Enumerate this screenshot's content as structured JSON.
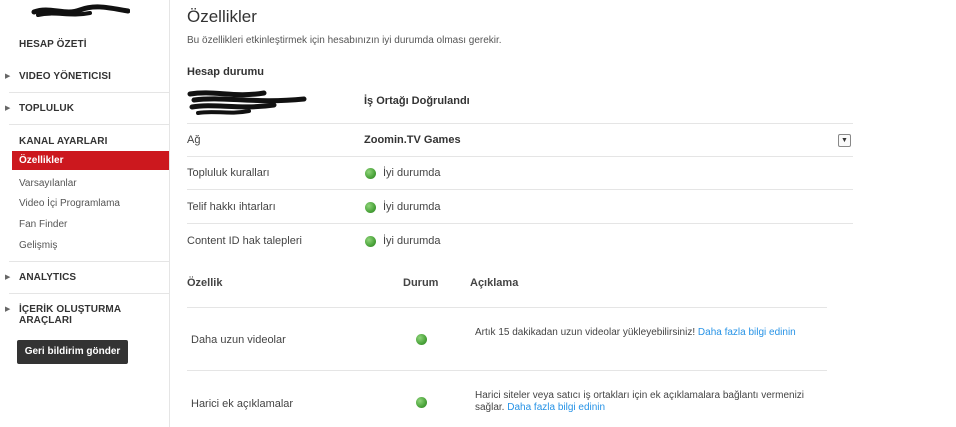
{
  "sidebar": {
    "hesap_ozeti": "HESAP ÖZETİ",
    "video_yoneticisi": "VIDEO YÖNETICISI",
    "topluluk": "TOPLULUK",
    "kanal_ayarlari": "KANAL AYARLARI",
    "sub_items": [
      "Özellikler",
      "Varsayılanlar",
      "Video İçi Programlama",
      "Fan Finder",
      "Gelişmiş"
    ],
    "analytics": "ANALYTICS",
    "icerik_araclari": "İÇERİK OLUŞTURMA ARAÇLARI",
    "feedback_button": "Geri bildirim gönder"
  },
  "main": {
    "title": "Özellikler",
    "subtitle": "Bu özellikleri etkinleştirmek için hesabınızın iyi durumda olması gerekir.",
    "section_title": "Hesap durumu",
    "partner_status": "İş Ortağı Doğrulandı",
    "rows": [
      {
        "label": "Ağ",
        "value": "Zoomin.TV Games"
      },
      {
        "label": "Topluluk kuralları",
        "status": "İyi durumda"
      },
      {
        "label": "Telif hakkı ihtarları",
        "status": "İyi durumda"
      },
      {
        "label": "Content ID hak talepleri",
        "status": "İyi durumda"
      }
    ],
    "table_headers": {
      "feature": "Özellik",
      "status": "Durum",
      "description": "Açıklama"
    },
    "features": [
      {
        "name": "Daha uzun videolar",
        "desc": "Artık 15 dakikadan uzun videolar yükleyebilirsiniz!",
        "link": "Daha fazla bilgi edinin"
      },
      {
        "name": "Harici ek açıklamalar",
        "desc": "Harici siteler veya satıcı iş ortakları için ek açıklamalara bağlantı vermenizi sağlar.",
        "link": "Daha fazla bilgi edinin"
      }
    ]
  },
  "colors": {
    "accent_red": "#cc181e",
    "link_blue": "#2793e6",
    "status_green": "#4aa33a"
  },
  "icons": {
    "status": "green-dot-icon",
    "expand": "double-chevron-down-icon",
    "nav": "triangle-right-icon"
  }
}
